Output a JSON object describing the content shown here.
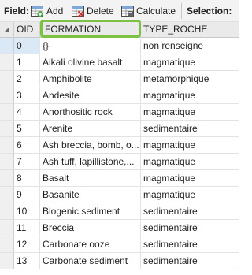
{
  "toolbar": {
    "field_label": "Field:",
    "add_label": "Add",
    "delete_label": "Delete",
    "calculate_label": "Calculate",
    "selection_label": "Selection:"
  },
  "table": {
    "columns": [
      "OID",
      "FORMATION",
      "TYPE_ROCHE"
    ],
    "rows": [
      {
        "oid": "0",
        "formation": "{}",
        "type": "non renseigne"
      },
      {
        "oid": "1",
        "formation": "Alkali olivine basalt",
        "type": "magmatique"
      },
      {
        "oid": "2",
        "formation": "Amphibolite",
        "type": "metamorphique"
      },
      {
        "oid": "3",
        "formation": "Andesite",
        "type": "magmatique"
      },
      {
        "oid": "4",
        "formation": "Anorthositic rock",
        "type": "magmatique"
      },
      {
        "oid": "5",
        "formation": "Arenite",
        "type": "sedimentaire"
      },
      {
        "oid": "6",
        "formation": "Ash breccia, bomb, o...",
        "type": "magmatique"
      },
      {
        "oid": "7",
        "formation": "Ash tuff, lapillistone,...",
        "type": "magmatique"
      },
      {
        "oid": "8",
        "formation": "Basalt",
        "type": "magmatique"
      },
      {
        "oid": "9",
        "formation": "Basanite",
        "type": "magmatique"
      },
      {
        "oid": "10",
        "formation": "Biogenic sediment",
        "type": "sedimentaire"
      },
      {
        "oid": "11",
        "formation": "Breccia",
        "type": "sedimentaire"
      },
      {
        "oid": "12",
        "formation": "Carbonate ooze",
        "type": "sedimentaire"
      },
      {
        "oid": "13",
        "formation": "Carbonate sediment",
        "type": "sedimentaire"
      }
    ]
  },
  "icons": {
    "add": "add-field-icon",
    "delete": "delete-field-icon",
    "calculate": "calculate-field-icon"
  },
  "colors": {
    "highlight": "#7dc142",
    "selected_row": "#dbe9f7"
  }
}
